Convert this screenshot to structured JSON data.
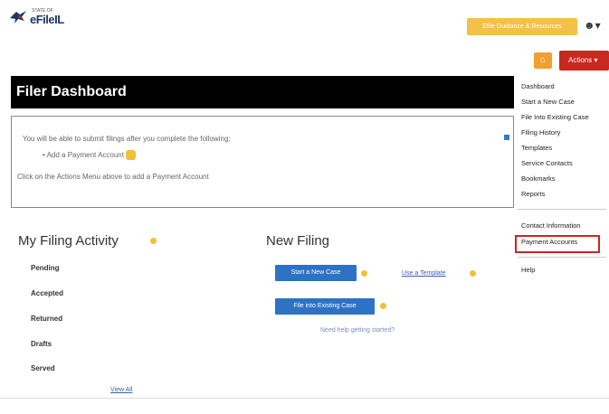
{
  "brand": {
    "logo_sub": "STATE OF",
    "logo_main": "eFileIL"
  },
  "header": {
    "cta_label": "Efile Guidance & Resources",
    "user_icon": "user-icon"
  },
  "toolbar": {
    "home_icon": "home-icon",
    "actions_label": "Actions ▾"
  },
  "dashboard": {
    "title": "Filer Dashboard",
    "notice_line1": "You will be able to submit filings after you complete the following:",
    "notice_item": "• Add a Payment Account",
    "notice_line3": "Click on the Actions Menu above to add a Payment Account"
  },
  "filing_activity": {
    "title": "My Filing Activity",
    "statuses": [
      "Pending",
      "Accepted",
      "Returned",
      "Drafts",
      "Served"
    ],
    "view_all": "View All"
  },
  "new_filing": {
    "title": "New Filing",
    "start_case_label": "Start a New Case",
    "use_template_label": "Use a Template",
    "file_existing_label": "File into Existing Case",
    "help_text": "Need help getting started?"
  },
  "actions_menu": {
    "items": [
      "Dashboard",
      "Start a New Case",
      "File Into Existing Case",
      "Filing History",
      "Templates",
      "Service Contacts",
      "Bookmarks",
      "Reports",
      "Contact Information",
      "Payment Accounts",
      "Help"
    ]
  },
  "colors": {
    "accent_red": "#c9271f",
    "accent_blue": "#2d72c4",
    "accent_yellow": "#f3c04a"
  }
}
